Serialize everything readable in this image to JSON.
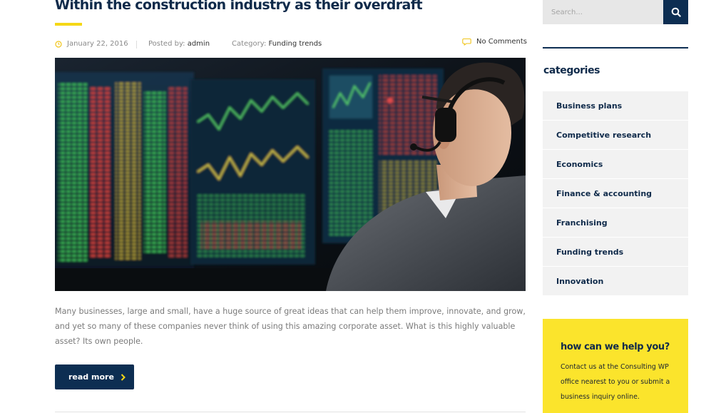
{
  "post": {
    "title": "Within the construction industry as their overdraft",
    "date": "January 22, 2016",
    "posted_by_label": "Posted by:",
    "author": "admin",
    "category_label": "Category:",
    "category": "Funding trends",
    "comments": "No Comments",
    "excerpt": "Many businesses, large and small, have a huge source of great ideas that can help them improve, innovate, and grow, and yet so many of these companies never think of using this amazing corporate asset. What is this highly valuable asset? Its own people.",
    "read_more_label": "read more",
    "image_icon": "trader-at-monitors-photo"
  },
  "sidebar": {
    "search": {
      "placeholder": "Search..."
    },
    "categories_heading": "categories",
    "categories": [
      {
        "label": "Business plans"
      },
      {
        "label": "Competitive research"
      },
      {
        "label": "Economics"
      },
      {
        "label": "Finance & accounting"
      },
      {
        "label": "Franchising"
      },
      {
        "label": "Funding trends"
      },
      {
        "label": "Innovation"
      }
    ],
    "help": {
      "title": "how can we help you?",
      "text": "Contact us at the Consulting WP office nearest to you or submit a business inquiry online."
    }
  },
  "colors": {
    "navy": "#0d2e52",
    "accent_yellow": "#f5d716",
    "help_box": "#fbe42c",
    "category_bg": "#f2f2f2"
  }
}
